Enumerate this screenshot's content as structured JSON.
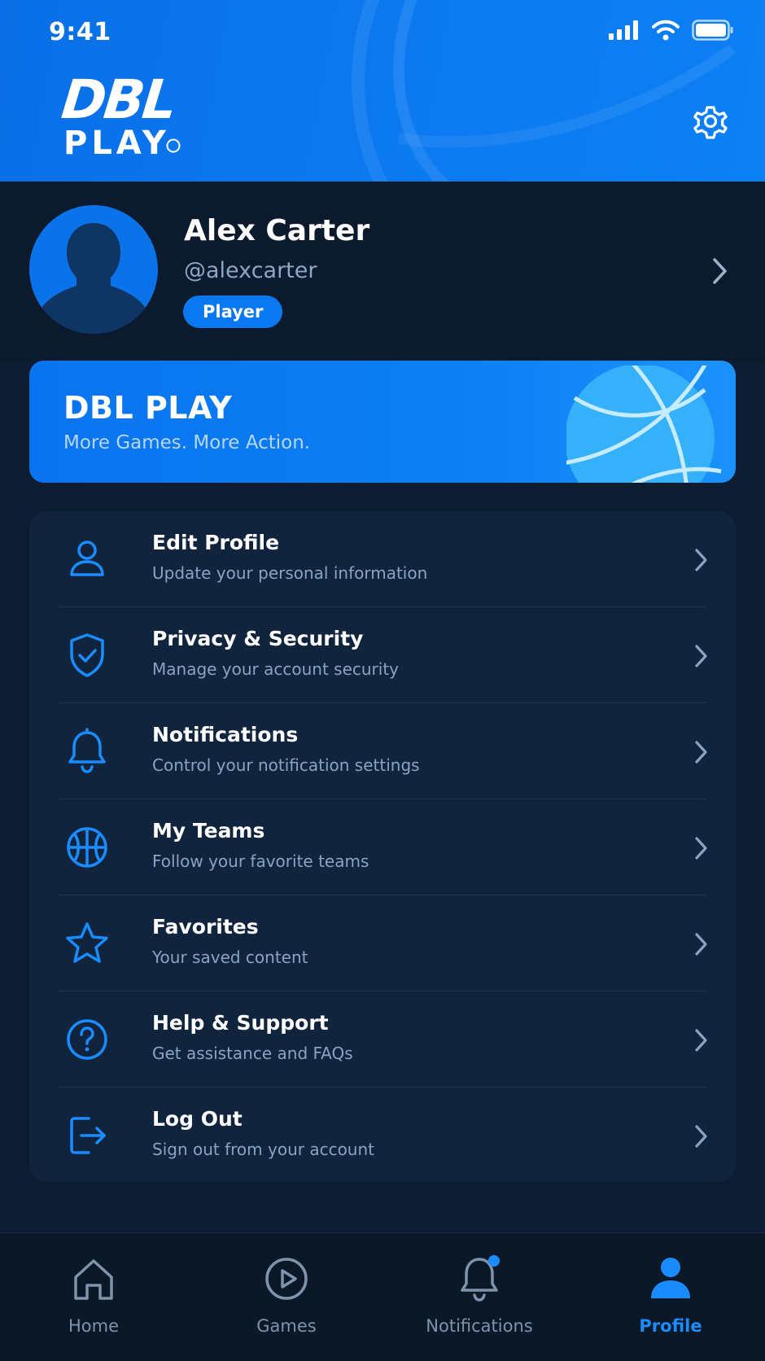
{
  "status_bar": {
    "time": "9:41"
  },
  "header": {
    "logo_top": "DBL",
    "logo_bottom": "PLAY"
  },
  "profile": {
    "name": "Alex Carter",
    "handle": "@alexcarter",
    "role_badge": "Player"
  },
  "banner": {
    "title": "DBL PLAY",
    "subtitle": "More Games. More Action."
  },
  "menu": {
    "items": [
      {
        "title": "Edit Profile",
        "subtitle": "Update your personal information",
        "icon": "user-icon"
      },
      {
        "title": "Privacy & Security",
        "subtitle": "Manage your account security",
        "icon": "shield-icon"
      },
      {
        "title": "Notifications",
        "subtitle": "Control your notification settings",
        "icon": "bell-icon"
      },
      {
        "title": "My Teams",
        "subtitle": "Follow your favorite teams",
        "icon": "basketball-icon"
      },
      {
        "title": "Favorites",
        "subtitle": "Your saved content",
        "icon": "star-icon"
      },
      {
        "title": "Help & Support",
        "subtitle": "Get assistance and FAQs",
        "icon": "question-icon"
      },
      {
        "title": "Log Out",
        "subtitle": "Sign out from your account",
        "icon": "logout-icon"
      }
    ]
  },
  "bottom_nav": {
    "items": [
      {
        "label": "Home",
        "icon": "home-icon",
        "active": false
      },
      {
        "label": "Games",
        "icon": "play-circle-icon",
        "active": false
      },
      {
        "label": "Notifications",
        "icon": "bell-icon",
        "active": false,
        "has_dot": true
      },
      {
        "label": "Profile",
        "icon": "user-icon",
        "active": true
      }
    ]
  },
  "colors": {
    "accent": "#0a78f0",
    "active_nav": "#1a8cff",
    "background": "#0c1c31",
    "card": "#10243e"
  }
}
